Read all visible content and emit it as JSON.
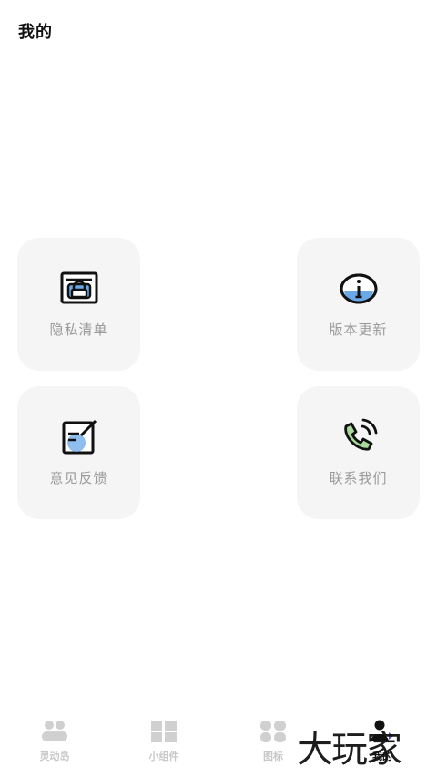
{
  "header": {
    "title": "我的"
  },
  "cards": [
    {
      "label": "隐私清单",
      "icon": "privacy-list-icon"
    },
    {
      "label": "版本更新",
      "icon": "info-icon"
    },
    {
      "label": "意见反馈",
      "icon": "feedback-edit-icon"
    },
    {
      "label": "联系我们",
      "icon": "phone-call-icon"
    }
  ],
  "nav": {
    "items": [
      {
        "label": "灵动岛",
        "icon": "dynamic-island-icon"
      },
      {
        "label": "小组件",
        "icon": "widgets-grid-icon"
      },
      {
        "label": "图标",
        "icon": "icons-grid-icon"
      },
      {
        "label": "我的",
        "icon": "profile-users-icon"
      }
    ]
  },
  "watermark": {
    "text": "大玩家"
  },
  "colors": {
    "card_bg": "#f5f5f5",
    "label_gray": "#9a9a9a",
    "accent_blue": "#6aa8e8",
    "accent_green": "#a8d89a",
    "nav_inactive": "#c8c8c8",
    "nav_active": "#111111"
  }
}
